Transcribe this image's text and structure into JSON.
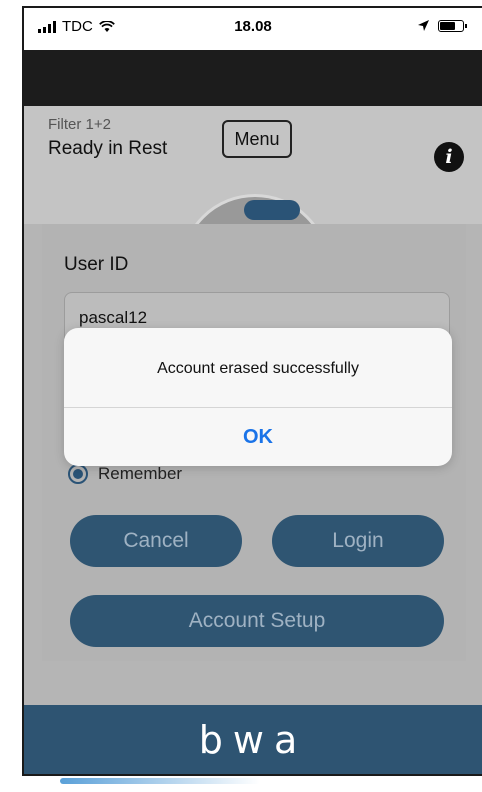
{
  "status_bar": {
    "carrier": "TDC",
    "time": "18.08",
    "icons": [
      "signal-icon",
      "wifi-icon",
      "location-arrow-icon",
      "battery-icon"
    ]
  },
  "header": {
    "filter_label": "Filter 1+2",
    "status": "Ready in Rest",
    "menu_label": "Menu",
    "info_icon": "i"
  },
  "login": {
    "userid_label": "User ID",
    "userid_value": "pascal12",
    "remember_label": "Remember",
    "cancel_label": "Cancel",
    "login_label": "Login",
    "setup_label": "Account Setup"
  },
  "alert": {
    "message": "Account erased successfully",
    "ok_label": "OK"
  },
  "footer": {
    "logo_text": "bwa"
  },
  "colors": {
    "primary": "#2f5572",
    "footer": "#2e5472",
    "alert_ok": "#1a73e8",
    "overlay_gray": "#b5b5b5"
  }
}
